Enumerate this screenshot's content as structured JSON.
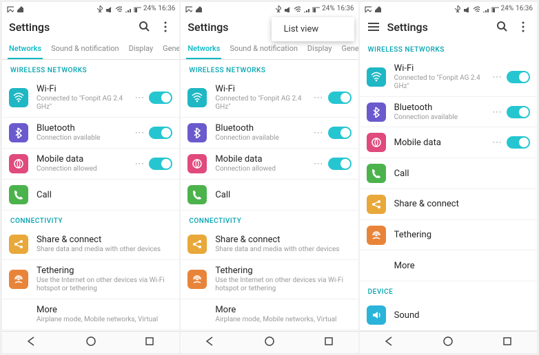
{
  "status": {
    "battery": "24%",
    "time": "16:36"
  },
  "s1": {
    "title": "Settings",
    "tabs": [
      "Networks",
      "Sound & notification",
      "Display",
      "General"
    ],
    "sections": {
      "wireless": "WIRELESS NETWORKS",
      "connectivity": "CONNECTIVITY"
    },
    "items": {
      "wifi": {
        "title": "Wi-Fi",
        "sub": "Connected to \"Fonpit AG 2.4 GHz\""
      },
      "bt": {
        "title": "Bluetooth",
        "sub": "Connection available"
      },
      "data": {
        "title": "Mobile data",
        "sub": "Connection allowed"
      },
      "call": {
        "title": "Call"
      },
      "share": {
        "title": "Share & connect",
        "sub": "Share data and media with other devices"
      },
      "tether": {
        "title": "Tethering",
        "sub": "Use the Internet on other devices via Wi-Fi hotspot or tethering"
      },
      "more": {
        "title": "More",
        "sub": "Airplane mode, Mobile networks, Virtual"
      }
    }
  },
  "s2": {
    "popup": "List view"
  },
  "s3": {
    "title": "Settings",
    "sections": {
      "wireless": "WIRELESS NETWORKS",
      "device": "DEVICE"
    },
    "items": {
      "wifi": {
        "title": "Wi-Fi",
        "sub": "Connected to \"Fonpit AG 2.4 GHz\""
      },
      "bt": {
        "title": "Bluetooth",
        "sub": "Connection available"
      },
      "data": {
        "title": "Mobile data"
      },
      "call": {
        "title": "Call"
      },
      "share": {
        "title": "Share & connect"
      },
      "tether": {
        "title": "Tethering"
      },
      "more": {
        "title": "More"
      },
      "sound": {
        "title": "Sound"
      }
    }
  }
}
